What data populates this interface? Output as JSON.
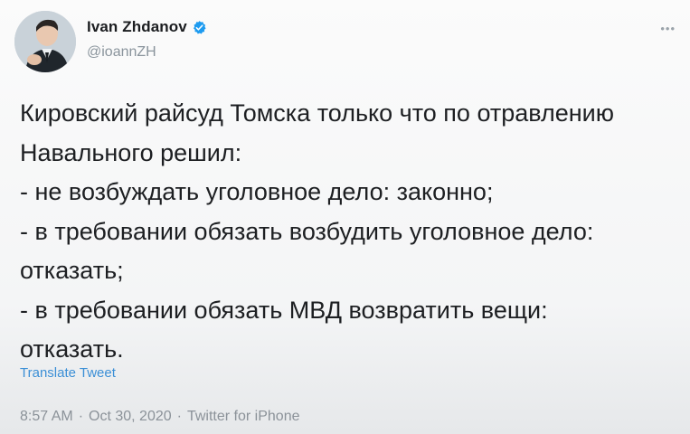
{
  "author": {
    "name": "Ivan Zhdanov",
    "handle": "@ioannZH",
    "avatar_icon": "person-avatar",
    "verified_icon": "verified-badge-icon"
  },
  "tweet": {
    "text": "Кировский райсуд Томска только что по отравлению\nНавального решил:\n - не возбуждать уголовное дело: законно;\n- в требовании обязать возбудить уголовное дело:\nотказать;\n- в требовании обязать МВД возвратить вещи:\nотказать.",
    "translate_label": "Translate Tweet"
  },
  "meta": {
    "time": "8:57 AM",
    "separator1": "·",
    "date": "Oct 30, 2020",
    "separator2": "·",
    "source": "Twitter for iPhone"
  },
  "colors": {
    "link": "#3b8fd6",
    "verified": "#1d9bf0",
    "secondary_text": "#8a949c"
  }
}
